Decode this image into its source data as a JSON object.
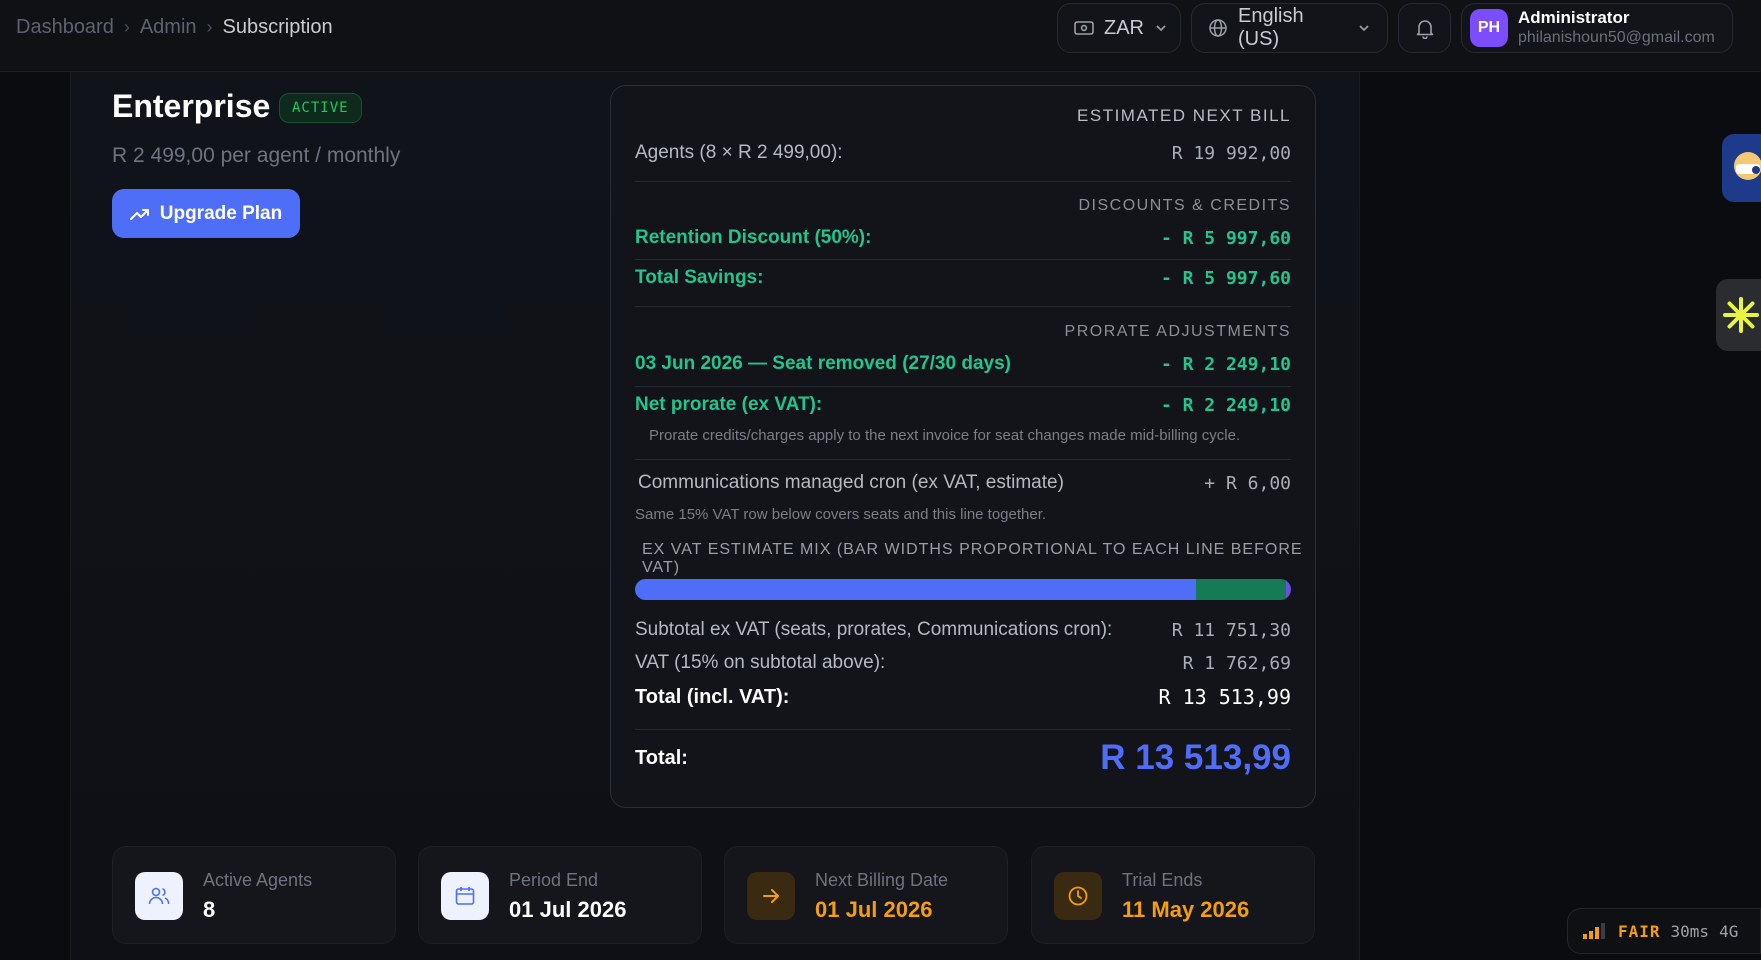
{
  "breadcrumb": [
    "Dashboard",
    "Admin",
    "Subscription"
  ],
  "header": {
    "currency": "ZAR",
    "language": "English (US)",
    "user": {
      "initials": "PH",
      "name": "Administrator",
      "email": "philanishoun50@gmail.com"
    }
  },
  "plan": {
    "name": "Enterprise",
    "status": "ACTIVE",
    "price": "R 2 499,00 per agent / monthly",
    "upgrade_label": "Upgrade Plan"
  },
  "bill": {
    "heading": "ESTIMATED NEXT BILL",
    "agents_label": "Agents (8 × R 2 499,00):",
    "agents_value": "R 19 992,00",
    "discounts_heading": "DISCOUNTS & CREDITS",
    "retention_label": "Retention Discount (50%):",
    "retention_value": "- R 5 997,60",
    "savings_label": "Total Savings:",
    "savings_value": "- R 5 997,60",
    "prorate_heading": "PRORATE ADJUSTMENTS",
    "prorate_item_label": "03 Jun 2026 — Seat removed (27/30 days)",
    "prorate_item_value": "- R 2 249,10",
    "net_prorate_label": "Net prorate (ex VAT):",
    "net_prorate_value": "- R 2 249,10",
    "prorate_note": "Prorate credits/charges apply to the next invoice for seat changes made mid-billing cycle.",
    "cron_label": "Communications managed cron (ex VAT, estimate)",
    "cron_value": "+ R 6,00",
    "cron_note": "Same 15% VAT row below covers seats and this line together.",
    "mix_heading": "EX VAT ESTIMATE MIX (BAR WIDTHS PROPORTIONAL TO EACH LINE BEFORE VAT)",
    "mix": [
      {
        "name": "seats",
        "fraction": 0.855,
        "color": "#4f6ef7"
      },
      {
        "name": "prorates",
        "fraction": 0.138,
        "color": "#157a56"
      },
      {
        "name": "communications cron",
        "fraction": 0.007,
        "color": "#6d4ee0"
      }
    ],
    "subtotal_label": "Subtotal ex VAT (seats, prorates, Communications cron):",
    "subtotal_value": "R 11 751,30",
    "vat_label": "VAT (15% on subtotal above):",
    "vat_value": "R 1 762,69",
    "total_incl_label": "Total (incl. VAT):",
    "total_incl_value": "R 13 513,99",
    "total_label": "Total:",
    "total_value": "R 13 513,99"
  },
  "stats": [
    {
      "label": "Active Agents",
      "value": "8",
      "icon": "users-icon"
    },
    {
      "label": "Period End",
      "value": "01 Jul 2026",
      "icon": "calendar-icon"
    },
    {
      "label": "Next Billing Date",
      "value": "01 Jul 2026",
      "icon": "arrow-right-icon"
    },
    {
      "label": "Trial Ends",
      "value": "11 May 2026",
      "icon": "clock-icon"
    }
  ],
  "network": {
    "status": "FAIR",
    "latency": "30ms",
    "type": "4G"
  },
  "colors": {
    "accent": "#4f6ef7",
    "success": "#22c58b",
    "warning": "#f59e0b"
  }
}
